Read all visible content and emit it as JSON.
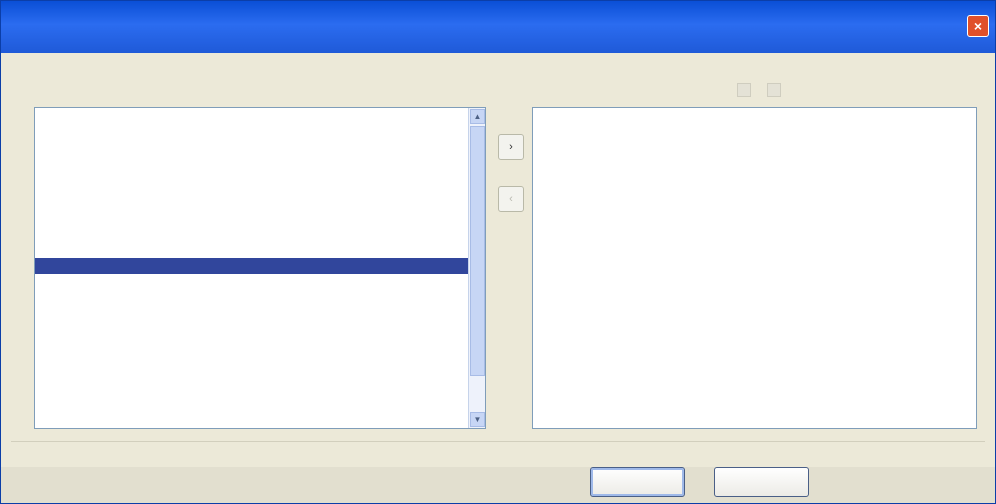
{
  "window": {
    "title": "",
    "close_glyph": "×",
    "titlebar_color": "#0a4fd6"
  },
  "available": {
    "label": "",
    "rows": [
      {
        "c1": "",
        "c2": "",
        "bold": true
      },
      {
        "c1": "",
        "c2": "",
        "bold": true
      },
      {
        "c1": "",
        "c2": "",
        "bold": true
      },
      {
        "c1": "",
        "c2": "",
        "bold": true
      },
      {
        "c1": "",
        "c2": "",
        "bold": true
      },
      {
        "c1": "",
        "c2": "",
        "bold": true
      },
      {
        "c1": "",
        "c2": "",
        "bold": true
      },
      {
        "c1": "",
        "c2": "",
        "bold": true
      },
      {
        "c1": "",
        "c2": "",
        "bold": true
      },
      {
        "c1": "",
        "c2": "",
        "state": "selected"
      },
      {
        "c1": "",
        "c2": ""
      },
      {
        "c1": "",
        "c2": ""
      },
      {
        "c1": "",
        "c2": ""
      },
      {
        "c1": "",
        "c2": ""
      },
      {
        "c1": "",
        "c2": ""
      },
      {
        "c1": "",
        "c2": ""
      },
      {
        "c1": "",
        "c2": ""
      },
      {
        "c1": "",
        "c2": ""
      }
    ],
    "selected_color": "#31469c"
  },
  "selected": {
    "label": "",
    "rows": [
      {
        "c1": "",
        "bold": true
      },
      {
        "c1": "",
        "bold": true
      },
      {
        "c1": "",
        "bold": true
      }
    ]
  },
  "buttons": {
    "add_glyph": "›",
    "remove_glyph": "‹",
    "ok": "",
    "cancel": ""
  },
  "icons": {
    "scroll_up": "▲",
    "scroll_down": "▼",
    "tool_icon_1": "edit-icon",
    "tool_icon_2": "delete-icon"
  }
}
